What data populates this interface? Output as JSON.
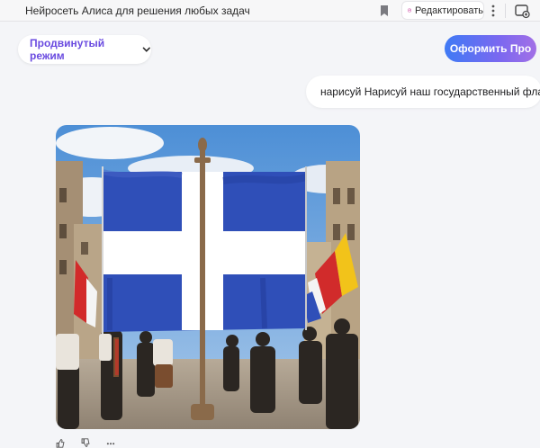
{
  "browser": {
    "tab_title": "Нейросеть Алиса для решения любых задач",
    "edit_label": "Редактировать",
    "icons": [
      "bookmark-icon",
      "edit-icon",
      "more-vertical-icon",
      "screenshot-icon"
    ]
  },
  "chat": {
    "mode_label": "Продвинутый режим",
    "pro_button_label": "Оформить Про",
    "user_message": "нарисуй Нарисуй наш государственный флаг",
    "actions": [
      "like-icon",
      "dislike-icon",
      "more-horizontal-icon"
    ]
  },
  "colors": {
    "accent_purple": "#6a4be0",
    "pro_gradient_start": "#3f7af5",
    "pro_gradient_end": "#a270e6",
    "flag_blue": "#2f4fb8",
    "flag_white": "#ffffff"
  }
}
